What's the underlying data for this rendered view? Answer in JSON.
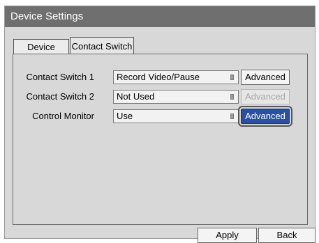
{
  "window": {
    "title": "Device Settings"
  },
  "tabs": [
    {
      "label": "Device"
    },
    {
      "label": "Contact Switch"
    }
  ],
  "rows": [
    {
      "label": "Contact Switch 1",
      "value": "Record Video/Pause",
      "advanced": "Advanced",
      "advanced_state": "enabled"
    },
    {
      "label": "Contact Switch 2",
      "value": "Not Used",
      "advanced": "Advanced",
      "advanced_state": "disabled"
    },
    {
      "label": "Control Monitor",
      "value": "Use",
      "advanced": "Advanced",
      "advanced_state": "focused"
    }
  ],
  "buttons": {
    "apply": "Apply",
    "back": "Back"
  },
  "colors": {
    "titlebar": "#6f6f6f",
    "accent": "#2a4fa3",
    "panel": "#d8d8d8"
  }
}
